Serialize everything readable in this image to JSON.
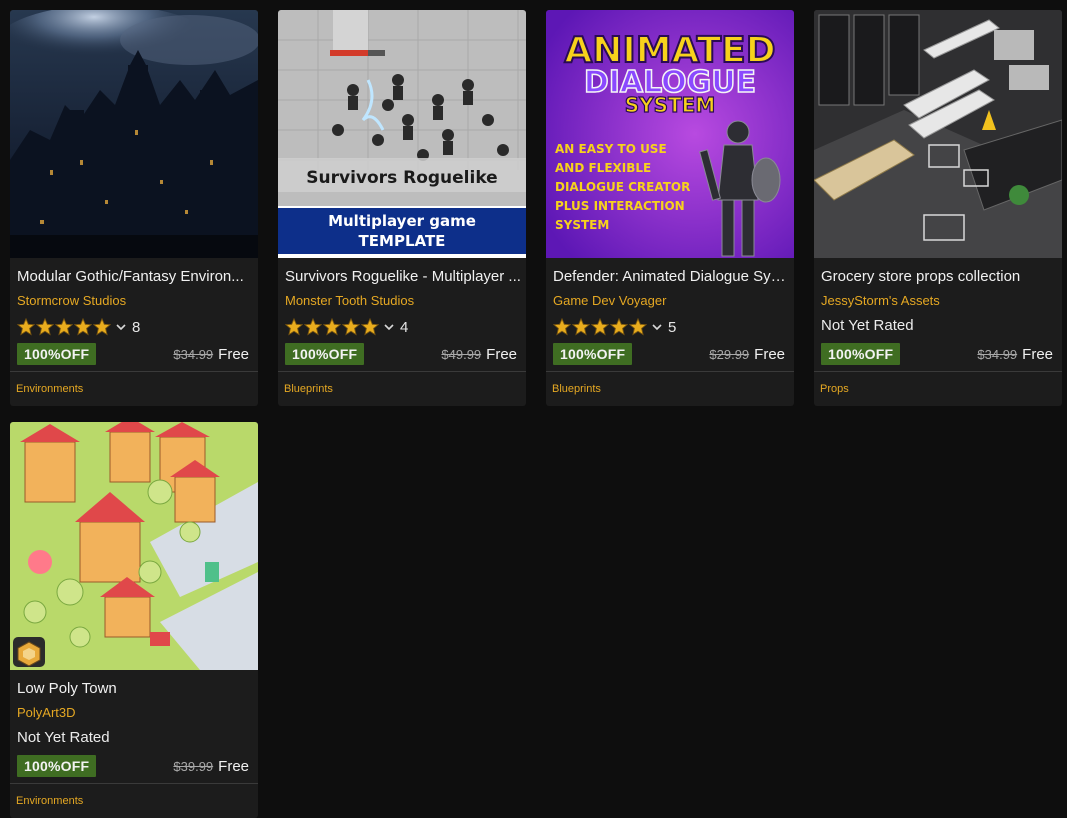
{
  "products": [
    {
      "title": "Modular Gothic/Fantasy Environ...",
      "publisher": "Stormcrow Studios",
      "rating_stars": 5,
      "review_count": "8",
      "discount": "100%OFF",
      "old_price": "$34.99",
      "price": "Free",
      "category": "Environments"
    },
    {
      "title": "Survivors Roguelike - Multiplayer ...",
      "publisher": "Monster Tooth Studios",
      "rating_stars": 5,
      "review_count": "4",
      "discount": "100%OFF",
      "old_price": "$49.99",
      "price": "Free",
      "category": "Blueprints",
      "thumb_text": {
        "line1": "Survivors Roguelike",
        "line2": "Multiplayer game",
        "line3": "template"
      }
    },
    {
      "title": "Defender: Animated Dialogue Sys...",
      "publisher": "Game Dev Voyager",
      "rating_stars": 5,
      "review_count": "5",
      "discount": "100%OFF",
      "old_price": "$29.99",
      "price": "Free",
      "category": "Blueprints",
      "thumb_text": {
        "line1": "ANIMATED",
        "line2": "DIALOGUE",
        "line3": "SYSTEM",
        "tag1": "AN EASY TO USE",
        "tag2": "AND FLEXIBLE",
        "tag3": "DIALOGUE CREATOR",
        "tag4": "PLUS INTERACTION",
        "tag5": "SYSTEM"
      }
    },
    {
      "title": "Grocery store props collection",
      "publisher": "JessyStorm's Assets",
      "rating_text": "Not Yet Rated",
      "discount": "100%OFF",
      "old_price": "$34.99",
      "price": "Free",
      "category": "Props"
    },
    {
      "title": "Low Poly Town",
      "publisher": "PolyArt3D",
      "rating_text": "Not Yet Rated",
      "discount": "100%OFF",
      "old_price": "$39.99",
      "price": "Free",
      "category": "Environments"
    }
  ],
  "colors": {
    "background": "#0e0e0e",
    "card": "#1c1c1c",
    "accent": "#e5a823",
    "discount_badge": "#3f6d22",
    "star": "#e9ad1e"
  },
  "icons": {
    "rating": "star-icon",
    "expand": "chevron-down-icon",
    "platform": "hexagon-badge-icon"
  }
}
